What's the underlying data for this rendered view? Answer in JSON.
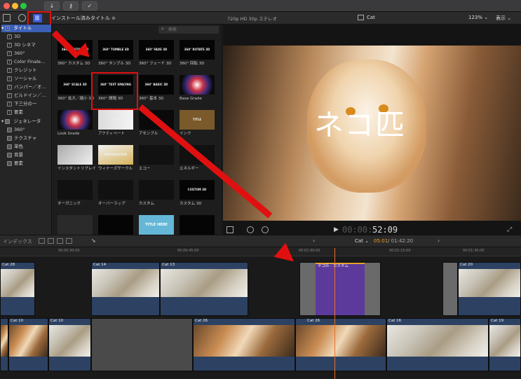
{
  "titlebar": {
    "library_label": "タイトル",
    "installed_label": "インストール済みタイトル ≎"
  },
  "search": {
    "placeholder": "検索"
  },
  "sidebar": {
    "items": [
      {
        "label": "3D"
      },
      {
        "label": "3D シネマ"
      },
      {
        "label": "360°"
      },
      {
        "label": "Color Finale…"
      },
      {
        "label": "クレジット"
      },
      {
        "label": "ソーシャル"
      },
      {
        "label": "バンパー／オ…"
      },
      {
        "label": "ビルドイン／…"
      },
      {
        "label": "下三分の一"
      },
      {
        "label": "要素"
      }
    ],
    "generator_label": "ジェネレータ",
    "gen_items": [
      {
        "label": "360°"
      },
      {
        "label": "テクスチャ"
      },
      {
        "label": "単色"
      },
      {
        "label": "背景"
      },
      {
        "label": "要素"
      }
    ]
  },
  "browser": {
    "thumbs": [
      {
        "caption": "360° カスタム 3D",
        "overlay": "360° CUSTOM 3D"
      },
      {
        "caption": "360° タンブル 3D",
        "overlay": "360° TUMBLE 3D"
      },
      {
        "caption": "360° フェード 3D",
        "overlay": "360° FADE 3D"
      },
      {
        "caption": "360° 回転 3D",
        "overlay": "360° ROTATE 3D"
      },
      {
        "caption": "360° 拡大／縮小 3D",
        "overlay": "360° SCALE 3D"
      },
      {
        "caption": "360° 間隔 3D",
        "overlay": "360° TEXT SPACING 3D"
      },
      {
        "caption": "360° 基本 3D",
        "overlay": "360° BASIC 3D"
      },
      {
        "caption": "Base Grade",
        "overlay": ""
      },
      {
        "caption": "Look Grade",
        "overlay": ""
      },
      {
        "caption": "アクティベート",
        "overlay": "TEXT"
      },
      {
        "caption": "アセンブル",
        "overlay": ""
      },
      {
        "caption": "インク",
        "overlay": "TITLE"
      },
      {
        "caption": "インスタントリプレイ",
        "overlay": ""
      },
      {
        "caption": "ウィナーズサークル",
        "overlay": "INFORMATION"
      },
      {
        "caption": "エコー",
        "overlay": ""
      },
      {
        "caption": "エネルギー",
        "overlay": ""
      },
      {
        "caption": "オーガニック",
        "overlay": ""
      },
      {
        "caption": "オーバーラップ",
        "overlay": ""
      },
      {
        "caption": "カスタム",
        "overlay": ""
      },
      {
        "caption": "カスタム 3D",
        "overlay": "CUSTOM 3D"
      },
      {
        "caption": "",
        "overlay": ""
      },
      {
        "caption": "",
        "overlay": ""
      },
      {
        "caption": "",
        "overlay": "TITLE HERE"
      },
      {
        "caption": "",
        "overlay": ""
      }
    ]
  },
  "viewer": {
    "format": "720p HD 30p ステレオ",
    "clip_name": "Cat",
    "zoom": "123% ⌄",
    "view": "表示 ⌄",
    "title_text": "ネコ匹",
    "timecode_dim": "00:00:",
    "timecode": "52:09"
  },
  "timebar": {
    "index_label": "インデックス",
    "project": "Cat ⌄",
    "duration_pos": "05:01",
    "duration_total": " / 01:42:20"
  },
  "ruler": {
    "ticks": [
      "00:00:30:00",
      "00:00:45:00",
      "00:01:00:00",
      "00:01:15:00",
      "00:01:30:00"
    ]
  },
  "timeline": {
    "clips_top": [
      {
        "label": "Cat 28"
      },
      {
        "label": "Cat 14"
      },
      {
        "label": "Cat 13"
      },
      {
        "label": "ネコ匹 - カスタム"
      },
      {
        "label": "Cat 20"
      }
    ],
    "clips_bottom": [
      {
        "label": "Cat 10"
      },
      {
        "label": "Cat 10"
      },
      {
        "label": "Cat 26"
      },
      {
        "label": "Cat 26"
      },
      {
        "label": "Cat 16"
      },
      {
        "label": "Cat 19"
      }
    ]
  },
  "colors": {
    "accent": "#e11010",
    "title_clip": "#5b3a9b",
    "clip_blue": "#2d4263",
    "playhead": "#e8702a"
  }
}
